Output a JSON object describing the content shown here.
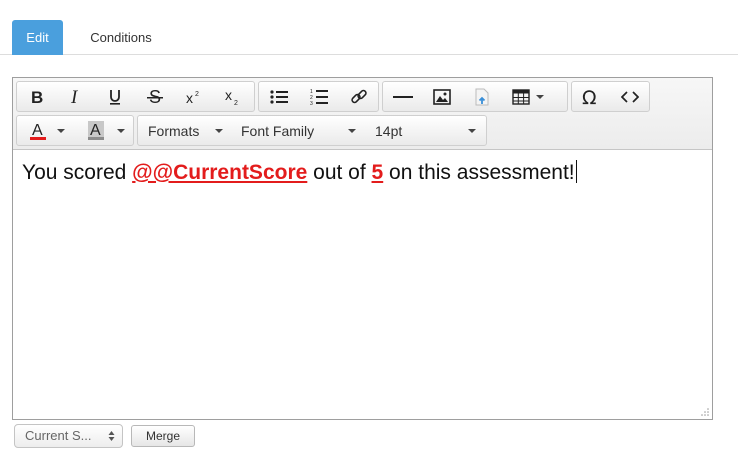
{
  "tabs": [
    {
      "label": "Edit",
      "active": true
    },
    {
      "label": "Conditions",
      "active": false
    }
  ],
  "toolbar": {
    "formats_label": "Formats",
    "font_family_label": "Font Family",
    "font_size_label": "14pt",
    "text_color": "#e31c1c",
    "bg_color": "#8c8c8c"
  },
  "content": {
    "text_before": "You scored ",
    "merge_field": "@@CurrentScore",
    "text_middle": " out of ",
    "max_score": "5",
    "text_after": " on this assessment!"
  },
  "bottom": {
    "select_value": "Current S...",
    "merge_button": "Merge"
  },
  "colors": {
    "tab_active": "#4a9fdd",
    "merge_highlight": "#e31c1c"
  }
}
